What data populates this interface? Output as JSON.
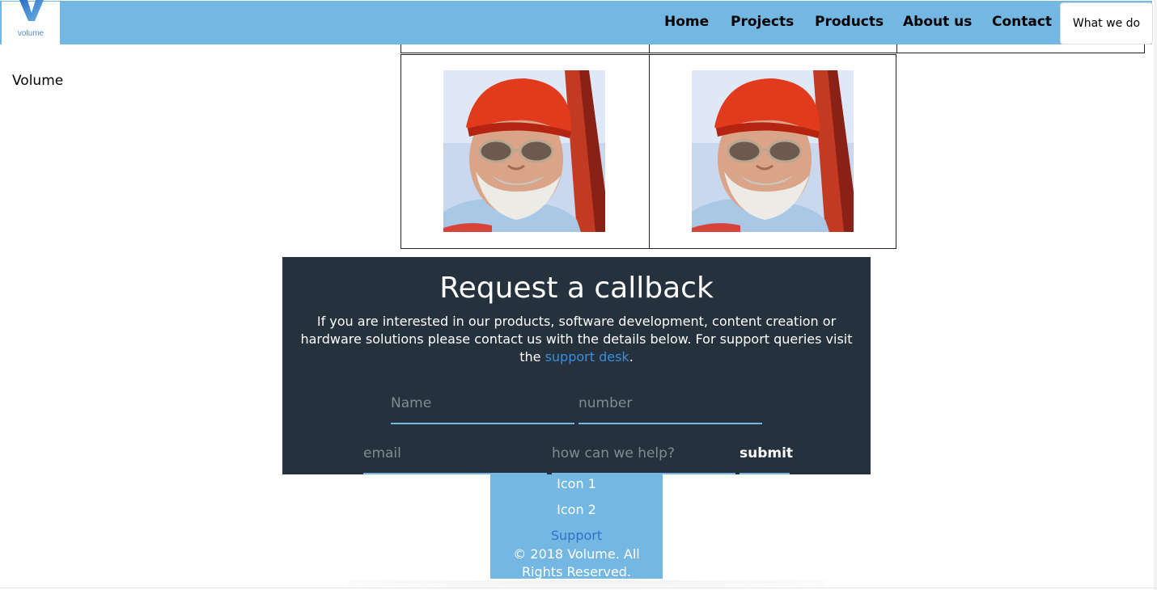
{
  "logo": {
    "text": "volume",
    "brand_color": "#4a90d9"
  },
  "nav": {
    "items": [
      {
        "label": "Home"
      },
      {
        "label": "Projects"
      },
      {
        "label": "Products"
      },
      {
        "label": "About us"
      },
      {
        "label": "Contact"
      }
    ],
    "highlight_label": "What we do",
    "bar_color": "#74b7e2"
  },
  "sidebar": {
    "title": "Volume"
  },
  "gallery": {
    "photo_count": 2
  },
  "callback": {
    "title": "Request a callback",
    "description_before": "If you are interested in our products, software development, content creation or hardware solutions please contact us with the details below. For support queries visit the ",
    "link_text": "support desk",
    "description_after": ".",
    "name_placeholder": "Name",
    "number_placeholder": "number",
    "email_placeholder": "email",
    "help_placeholder": "how can we help?",
    "submit_label": "submit",
    "bg_color": "#25313c"
  },
  "footer": {
    "icon1": "Icon 1",
    "icon2": "Icon 2",
    "support": "Support",
    "copyright": "© 2018 Volume. All Rights Reserved."
  }
}
